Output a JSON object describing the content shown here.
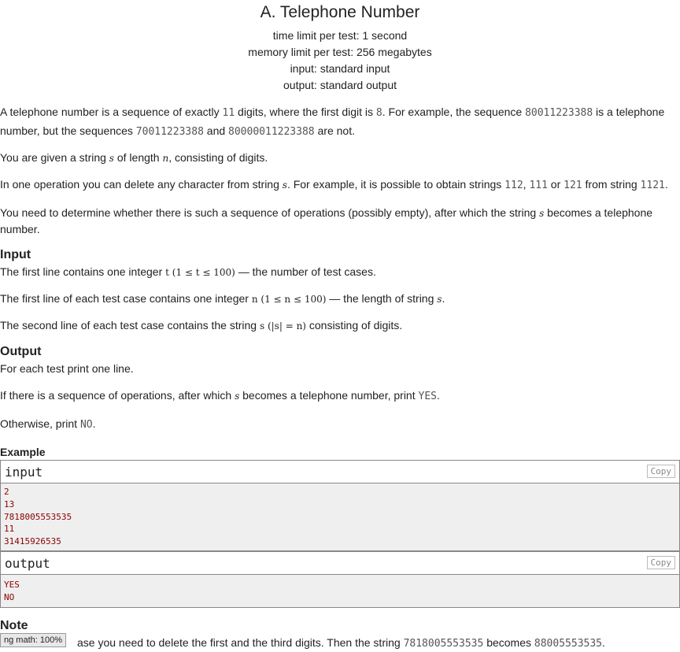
{
  "title": "A. Telephone Number",
  "meta": {
    "time_limit": "time limit per test: 1 second",
    "memory_limit": "memory limit per test: 256 megabytes",
    "input": "input: standard input",
    "output": "output: standard output"
  },
  "statement": {
    "p1_a": "A telephone number is a sequence of exactly ",
    "p1_code1": "11",
    "p1_b": " digits, where the first digit is ",
    "p1_code2": "8",
    "p1_c": ". For example, the sequence ",
    "p1_code3": "80011223388",
    "p1_d": " is a telephone number, but the sequences ",
    "p1_code4": "70011223388",
    "p1_e": " and ",
    "p1_code5": "80000011223388",
    "p1_f": " are not.",
    "p2_a": "You are given a string ",
    "p2_s": "s",
    "p2_b": " of length ",
    "p2_n": "n",
    "p2_c": ", consisting of digits.",
    "p3_a": "In one operation you can delete any character from string ",
    "p3_s": "s",
    "p3_b": ". For example, it is possible to obtain strings ",
    "p3_code1": "112",
    "p3_comma": ", ",
    "p3_code2": "111",
    "p3_or": " or ",
    "p3_code3": "121",
    "p3_c": " from string ",
    "p3_code4": "1121",
    "p3_d": ".",
    "p4_a": "You need to determine whether there is such a sequence of operations (possibly empty), after which the string ",
    "p4_s": "s",
    "p4_b": " becomes a telephone number."
  },
  "input_section": {
    "heading": "Input",
    "l1_a": "The first line contains one integer ",
    "l1_math": "t (1 ≤ t ≤ 100)",
    "l1_b": " — the number of test cases.",
    "l2_a": "The first line of each test case contains one integer ",
    "l2_math": "n (1 ≤ n ≤ 100)",
    "l2_b": " — the length of string ",
    "l2_s": "s",
    "l2_c": ".",
    "l3_a": "The second line of each test case contains the string ",
    "l3_math": "s (|s| = n)",
    "l3_b": " consisting of digits."
  },
  "output_section": {
    "heading": "Output",
    "l1": "For each test print one line.",
    "l2_a": "If there is a sequence of operations, after which ",
    "l2_s": "s",
    "l2_b": " becomes a telephone number, print ",
    "l2_code": "YES",
    "l2_c": ".",
    "l3_a": "Otherwise, print ",
    "l3_code": "NO",
    "l3_b": "."
  },
  "example": {
    "heading": "Example",
    "input_label": "input",
    "output_label": "output",
    "copy_label": "Copy",
    "input_lines": [
      "2",
      "13",
      "7818005553535",
      "11",
      "31415926535"
    ],
    "output_lines": [
      "YES",
      "NO"
    ]
  },
  "note": {
    "heading": "Note",
    "text_a": "ase you need to delete the first and the third digits. Then the string ",
    "code1": "7818005553535",
    "text_b": " becomes ",
    "code2": "88005553535",
    "text_c": "."
  },
  "status_bar": {
    "text": "ng math: 100%"
  }
}
